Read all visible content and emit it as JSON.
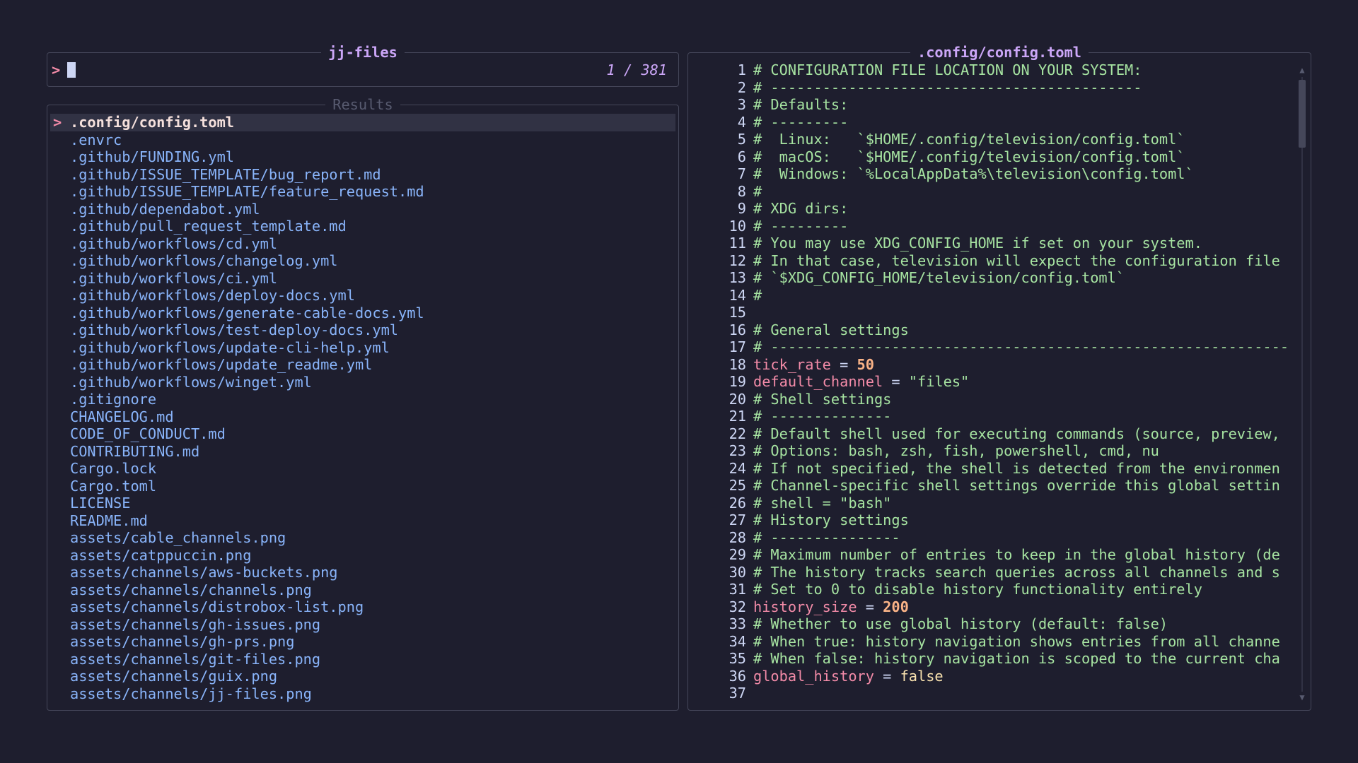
{
  "input": {
    "title": "jj-files",
    "prompt": ">",
    "query": "",
    "count": "1 / 381"
  },
  "results": {
    "title": "Results",
    "pointer": ">",
    "items": [
      ".config/config.toml",
      ".envrc",
      ".github/FUNDING.yml",
      ".github/ISSUE_TEMPLATE/bug_report.md",
      ".github/ISSUE_TEMPLATE/feature_request.md",
      ".github/dependabot.yml",
      ".github/pull_request_template.md",
      ".github/workflows/cd.yml",
      ".github/workflows/changelog.yml",
      ".github/workflows/ci.yml",
      ".github/workflows/deploy-docs.yml",
      ".github/workflows/generate-cable-docs.yml",
      ".github/workflows/test-deploy-docs.yml",
      ".github/workflows/update-cli-help.yml",
      ".github/workflows/update_readme.yml",
      ".github/workflows/winget.yml",
      ".gitignore",
      "CHANGELOG.md",
      "CODE_OF_CONDUCT.md",
      "CONTRIBUTING.md",
      "Cargo.lock",
      "Cargo.toml",
      "LICENSE",
      "README.md",
      "assets/cable_channels.png",
      "assets/catppuccin.png",
      "assets/channels/aws-buckets.png",
      "assets/channels/channels.png",
      "assets/channels/distrobox-list.png",
      "assets/channels/gh-issues.png",
      "assets/channels/gh-prs.png",
      "assets/channels/git-files.png",
      "assets/channels/guix.png",
      "assets/channels/jj-files.png"
    ]
  },
  "preview": {
    "title": ".config/config.toml",
    "lines": [
      {
        "n": "1",
        "parts": [
          {
            "t": "cm",
            "v": "# CONFIGURATION FILE LOCATION ON YOUR SYSTEM:"
          }
        ]
      },
      {
        "n": "2",
        "parts": [
          {
            "t": "cm",
            "v": "# -------------------------------------------"
          }
        ]
      },
      {
        "n": "3",
        "parts": [
          {
            "t": "cm",
            "v": "# Defaults:"
          }
        ]
      },
      {
        "n": "4",
        "parts": [
          {
            "t": "cm",
            "v": "# ---------"
          }
        ]
      },
      {
        "n": "5",
        "parts": [
          {
            "t": "cm",
            "v": "#  Linux:   `$HOME/.config/television/config.toml`"
          }
        ]
      },
      {
        "n": "6",
        "parts": [
          {
            "t": "cm",
            "v": "#  macOS:   `$HOME/.config/television/config.toml`"
          }
        ]
      },
      {
        "n": "7",
        "parts": [
          {
            "t": "cm",
            "v": "#  Windows: `%LocalAppData%\\television\\config.toml`"
          }
        ]
      },
      {
        "n": "8",
        "parts": [
          {
            "t": "cm",
            "v": "#"
          }
        ]
      },
      {
        "n": "9",
        "parts": [
          {
            "t": "cm",
            "v": "# XDG dirs:"
          }
        ]
      },
      {
        "n": "10",
        "parts": [
          {
            "t": "cm",
            "v": "# ---------"
          }
        ]
      },
      {
        "n": "11",
        "parts": [
          {
            "t": "cm",
            "v": "# You may use XDG_CONFIG_HOME if set on your system."
          }
        ]
      },
      {
        "n": "12",
        "parts": [
          {
            "t": "cm",
            "v": "# In that case, television will expect the configuration file"
          }
        ]
      },
      {
        "n": "13",
        "parts": [
          {
            "t": "cm",
            "v": "# `$XDG_CONFIG_HOME/television/config.toml`"
          }
        ]
      },
      {
        "n": "14",
        "parts": [
          {
            "t": "cm",
            "v": "#"
          }
        ]
      },
      {
        "n": "15",
        "parts": []
      },
      {
        "n": "16",
        "parts": [
          {
            "t": "cm",
            "v": "# General settings"
          }
        ]
      },
      {
        "n": "17",
        "parts": [
          {
            "t": "cm",
            "v": "# ------------------------------------------------------------"
          }
        ]
      },
      {
        "n": "18",
        "parts": [
          {
            "t": "key",
            "v": "tick_rate"
          },
          {
            "t": "op",
            "v": " = "
          },
          {
            "t": "num",
            "v": "50"
          }
        ]
      },
      {
        "n": "19",
        "parts": [
          {
            "t": "key",
            "v": "default_channel"
          },
          {
            "t": "op",
            "v": " = "
          },
          {
            "t": "str",
            "v": "\"files\""
          }
        ]
      },
      {
        "n": "20",
        "parts": [
          {
            "t": "cm",
            "v": "# Shell settings"
          }
        ]
      },
      {
        "n": "21",
        "parts": [
          {
            "t": "cm",
            "v": "# --------------"
          }
        ]
      },
      {
        "n": "22",
        "parts": [
          {
            "t": "cm",
            "v": "# Default shell used for executing commands (source, preview,"
          }
        ]
      },
      {
        "n": "23",
        "parts": [
          {
            "t": "cm",
            "v": "# Options: bash, zsh, fish, powershell, cmd, nu"
          }
        ]
      },
      {
        "n": "24",
        "parts": [
          {
            "t": "cm",
            "v": "# If not specified, the shell is detected from the environmen"
          }
        ]
      },
      {
        "n": "25",
        "parts": [
          {
            "t": "cm",
            "v": "# Channel-specific shell settings override this global settin"
          }
        ]
      },
      {
        "n": "26",
        "parts": [
          {
            "t": "cm",
            "v": "# shell = \"bash\""
          }
        ]
      },
      {
        "n": "27",
        "parts": [
          {
            "t": "cm",
            "v": "# History settings"
          }
        ]
      },
      {
        "n": "28",
        "parts": [
          {
            "t": "cm",
            "v": "# ---------------"
          }
        ]
      },
      {
        "n": "29",
        "parts": [
          {
            "t": "cm",
            "v": "# Maximum number of entries to keep in the global history (de"
          }
        ]
      },
      {
        "n": "30",
        "parts": [
          {
            "t": "cm",
            "v": "# The history tracks search queries across all channels and s"
          }
        ]
      },
      {
        "n": "31",
        "parts": [
          {
            "t": "cm",
            "v": "# Set to 0 to disable history functionality entirely"
          }
        ]
      },
      {
        "n": "32",
        "parts": [
          {
            "t": "key",
            "v": "history_size"
          },
          {
            "t": "op",
            "v": " = "
          },
          {
            "t": "num",
            "v": "200"
          }
        ]
      },
      {
        "n": "33",
        "parts": [
          {
            "t": "cm",
            "v": "# Whether to use global history (default: false)"
          }
        ]
      },
      {
        "n": "34",
        "parts": [
          {
            "t": "cm",
            "v": "# When true: history navigation shows entries from all channe"
          }
        ]
      },
      {
        "n": "35",
        "parts": [
          {
            "t": "cm",
            "v": "# When false: history navigation is scoped to the current cha"
          }
        ]
      },
      {
        "n": "36",
        "parts": [
          {
            "t": "key",
            "v": "global_history"
          },
          {
            "t": "op",
            "v": " = "
          },
          {
            "t": "bool",
            "v": "false"
          }
        ]
      },
      {
        "n": "37",
        "parts": []
      }
    ],
    "scrollbar": {
      "up_icon": "▲",
      "down_icon": "▼",
      "position": 0.0
    }
  },
  "colors": {
    "background": "#1e1e2e",
    "border": "#45475a",
    "accent": "#cba6f7",
    "pointer": "#f38ba8",
    "path": "#89b4fa",
    "comment": "#a6e3a1",
    "key": "#f38ba8",
    "number": "#fab387"
  }
}
